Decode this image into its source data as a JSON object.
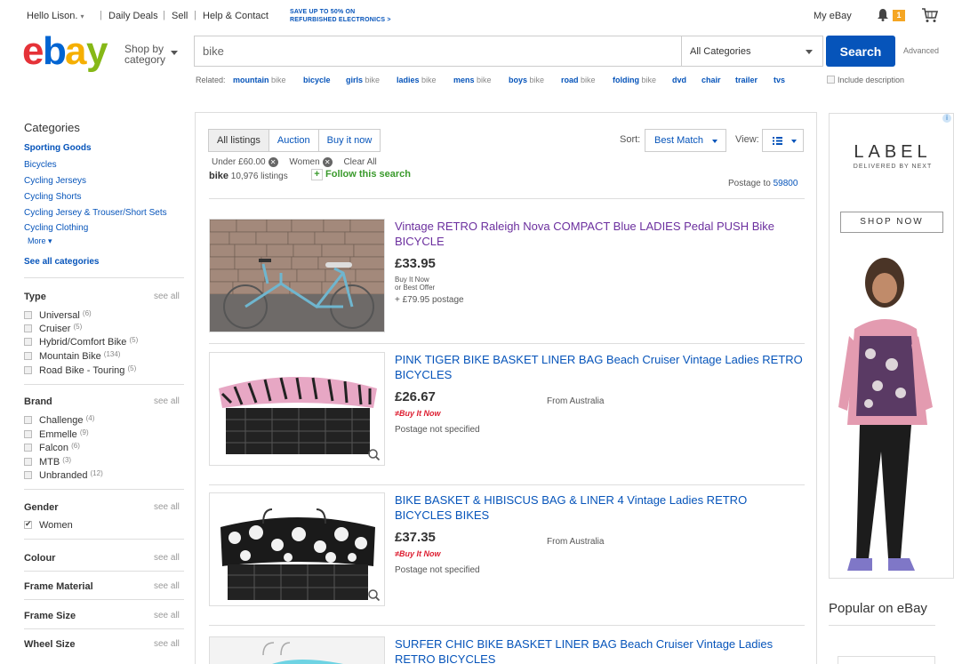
{
  "topbar": {
    "greeting": "Hello Lison.",
    "daily_deals": "Daily Deals",
    "sell": "Sell",
    "help": "Help & Contact",
    "promo_line1": "SAVE UP TO 50% ON",
    "promo_line2": "REFURBISHED ELECTRONICS >",
    "my_ebay": "My eBay",
    "notification_count": "1"
  },
  "header": {
    "shop_by_line1": "Shop by",
    "shop_by_line2": "category",
    "search_value": "bike",
    "category_select": "All Categories",
    "search_button": "Search",
    "advanced": "Advanced",
    "include_description": "Include description",
    "related_label": "Related:",
    "related": [
      {
        "bold": "mountain",
        "rest": " bike"
      },
      {
        "bold": "bicycle",
        "rest": ""
      },
      {
        "bold": "girls",
        "rest": " bike"
      },
      {
        "bold": "ladies",
        "rest": " bike"
      },
      {
        "bold": "mens",
        "rest": " bike"
      },
      {
        "bold": "boys",
        "rest": " bike"
      },
      {
        "bold": "road",
        "rest": " bike"
      },
      {
        "bold": "folding",
        "rest": " bike"
      },
      {
        "bold": "dvd",
        "rest": ""
      },
      {
        "bold": "chair",
        "rest": ""
      },
      {
        "bold": "trailer",
        "rest": ""
      },
      {
        "bold": "tvs",
        "rest": ""
      }
    ]
  },
  "sidebar": {
    "categories_heading": "Categories",
    "parent_category": "Sporting Goods",
    "categories": [
      "Bicycles",
      "Cycling Jerseys",
      "Cycling Shorts",
      "Cycling Jersey & Trouser/Short Sets",
      "Cycling Clothing"
    ],
    "more": "More",
    "see_all_categories": "See all categories",
    "see_all": "see all",
    "type_heading": "Type",
    "type_items": [
      {
        "label": "Universal",
        "count": "(6)"
      },
      {
        "label": "Cruiser",
        "count": "(5)"
      },
      {
        "label": "Hybrid/Comfort Bike",
        "count": "(5)"
      },
      {
        "label": "Mountain Bike",
        "count": "(134)"
      },
      {
        "label": "Road Bike - Touring",
        "count": "(5)"
      }
    ],
    "brand_heading": "Brand",
    "brand_items": [
      {
        "label": "Challenge",
        "count": "(4)"
      },
      {
        "label": "Emmelle",
        "count": "(9)"
      },
      {
        "label": "Falcon",
        "count": "(6)"
      },
      {
        "label": "MTB",
        "count": "(3)"
      },
      {
        "label": "Unbranded",
        "count": "(12)"
      }
    ],
    "gender_heading": "Gender",
    "gender_item": "Women",
    "colour_heading": "Colour",
    "frame_material_heading": "Frame Material",
    "frame_size_heading": "Frame Size",
    "wheel_size_heading": "Wheel Size"
  },
  "results": {
    "tabs": [
      "All listings",
      "Auction",
      "Buy it now"
    ],
    "sort_label": "Sort:",
    "sort_value": "Best Match",
    "view_label": "View:",
    "chip1": "Under £60.00",
    "chip2": "Women",
    "clear_all": "Clear All",
    "query": "bike",
    "count": "10,976 listings",
    "follow": "Follow this search",
    "postage_to_label": "Postage to",
    "postage_to_code": "59800",
    "items": [
      {
        "title": "Vintage RETRO Raleigh Nova COMPACT Blue LADIES Pedal PUSH Bike BICYCLE",
        "price": "£33.95",
        "format_line1": "Buy It Now",
        "format_line2": "or Best Offer",
        "postage": "+ £79.95 postage"
      },
      {
        "title": "PINK TIGER BIKE BASKET LINER BAG Beach Cruiser Vintage Ladies RETRO BICYCLES",
        "price": "£26.67",
        "bin": "Buy It Now",
        "postage": "Postage not specified",
        "from": "From Australia"
      },
      {
        "title": "BIKE BASKET & HIBISCUS BAG & LINER 4 Vintage Ladies RETRO BICYCLES BIKES",
        "price": "£37.35",
        "bin": "Buy It Now",
        "postage": "Postage not specified",
        "from": "From Australia"
      },
      {
        "title": "SURFER CHIC BIKE BASKET LINER BAG Beach Cruiser Vintage Ladies RETRO BICYCLES"
      }
    ]
  },
  "ad": {
    "brand": "LABEL",
    "tagline": "DELIVERED BY NEXT",
    "cta": "SHOP NOW"
  },
  "popular": "Popular on eBay",
  "colors": {
    "link": "#0654ba",
    "visited": "#6b2f9e",
    "search_button": "#0654ba",
    "buy_it_now": "#dd1e31",
    "follow_green": "#3a9a2c",
    "ebay_red": "#e53238",
    "ebay_blue": "#0064d2",
    "ebay_yellow": "#f5af02",
    "ebay_green": "#86b817"
  }
}
